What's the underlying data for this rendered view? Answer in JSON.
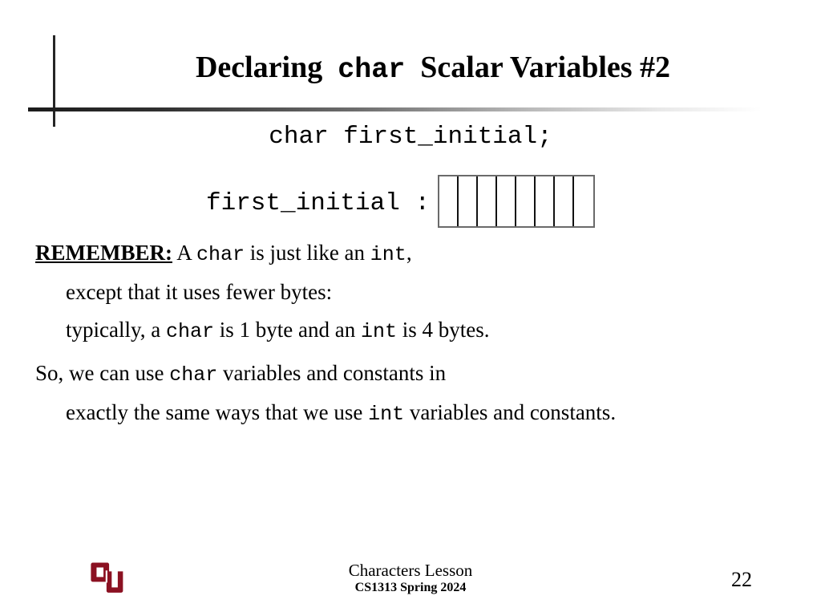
{
  "slide": {
    "title": {
      "part1": "Declaring",
      "mono": "char",
      "part2": "Scalar Variables #2"
    },
    "code_declaration": "char first_initial;",
    "variable_diagram": {
      "label": "first_initial :",
      "cell_count": 8,
      "cells": [
        "",
        "",
        "",
        "",
        "",
        "",
        "",
        ""
      ]
    },
    "body": {
      "para1": {
        "lead": "REMEMBER:",
        "text_a": " A ",
        "mono_a": "char",
        "text_b": " is just like an ",
        "mono_b": "int",
        "text_c": ","
      },
      "para1_line2": "except that it uses fewer bytes:",
      "para1_line3": {
        "text_a": "typically, a ",
        "mono_a": "char",
        "text_b": " is 1 byte and an ",
        "mono_b": "int",
        "text_c": " is 4 bytes."
      },
      "para2_line1": {
        "text_a": "So, we can use ",
        "mono_a": "char",
        "text_b": " variables and constants in"
      },
      "para2_line2": {
        "text_a": "exactly the same ways that we use ",
        "mono_a": "int",
        "text_b": " variables and constants."
      }
    },
    "footer": {
      "lesson": "Characters Lesson",
      "course": "CS1313 Spring 2024",
      "page_number": "22",
      "logo_name": "ou-logo",
      "logo_color": "#8B1122"
    }
  }
}
